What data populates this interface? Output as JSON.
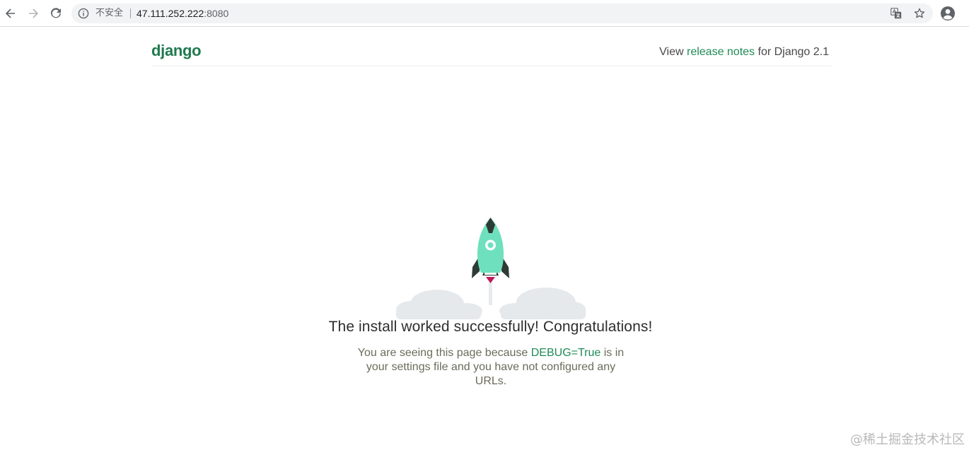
{
  "browser": {
    "security_label": "不安全",
    "url_host": "47.111.252.222",
    "url_port": ":8080"
  },
  "header": {
    "logo": "django",
    "release_prefix": "View ",
    "release_link": "release notes",
    "release_suffix": " for Django 2.1"
  },
  "main": {
    "headline": "The install worked successfully! Congratulations!",
    "explanation_prefix": "You are seeing this page because ",
    "debug_text": "DEBUG=True",
    "explanation_suffix": " is in your settings file and you have not configured any URLs."
  },
  "watermark": "@稀土掘金技术社区",
  "colors": {
    "django_green": "#1f7a4f",
    "link_green": "#1f8a55",
    "rocket_body": "#6ee0be",
    "rocket_fins": "#2e3b35",
    "flame": "#c2185b",
    "cloud": "#e6e9ec"
  }
}
